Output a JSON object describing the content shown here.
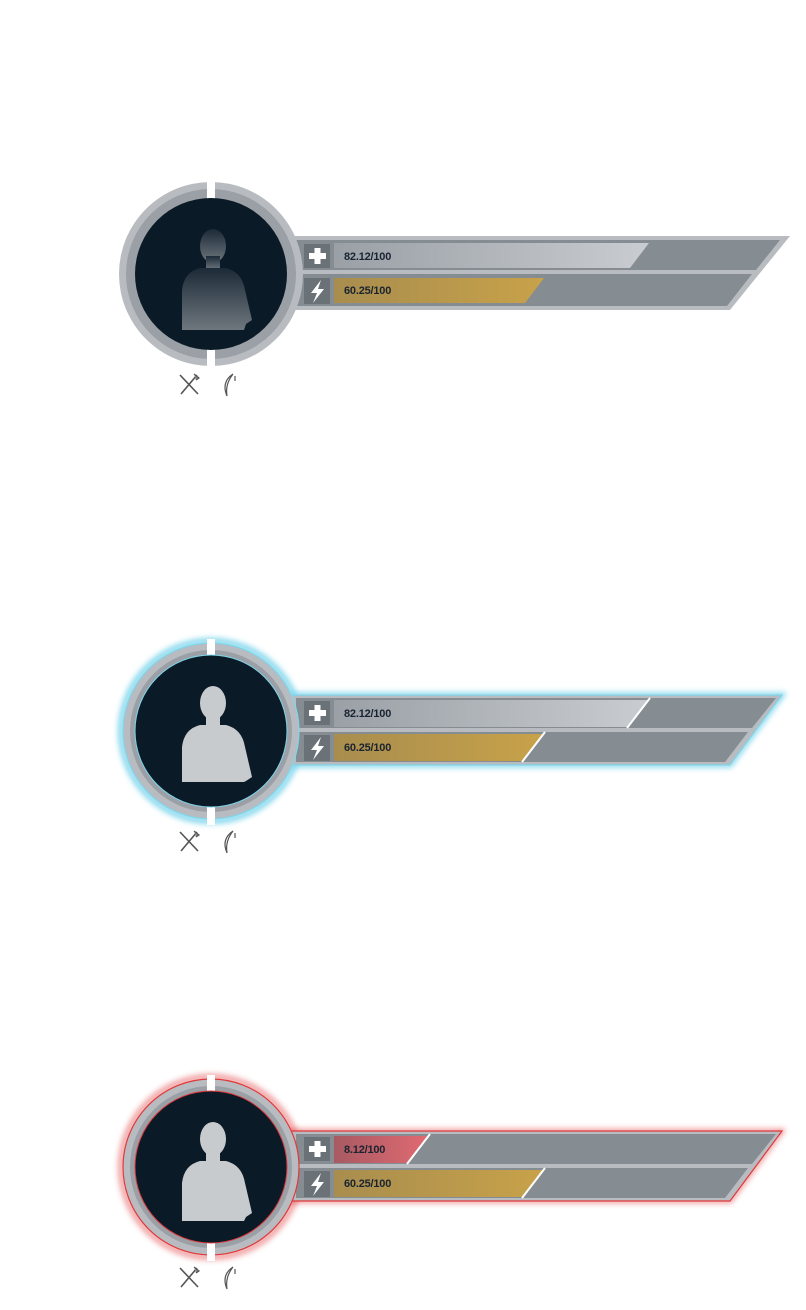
{
  "hud_panels": [
    {
      "state": "normal",
      "glow_color": "",
      "avatar_fill": "dark-gradient",
      "health": {
        "label": "82.12/100",
        "value": 82.12,
        "max": 100,
        "icon": "plus-icon"
      },
      "energy": {
        "label": "60.25/100",
        "value": 60.25,
        "max": 100,
        "icon": "lightning-icon"
      },
      "status_icons": [
        "crossed-tools-icon",
        "crescent-moon-icon"
      ]
    },
    {
      "state": "selected",
      "glow_color": "#7fd6ec",
      "avatar_fill": "light",
      "health": {
        "label": "82.12/100",
        "value": 82.12,
        "max": 100,
        "icon": "plus-icon"
      },
      "energy": {
        "label": "60.25/100",
        "value": 60.25,
        "max": 100,
        "icon": "lightning-icon"
      },
      "status_icons": [
        "crossed-tools-icon",
        "crescent-moon-icon"
      ]
    },
    {
      "state": "danger",
      "glow_color": "#e0393b",
      "avatar_fill": "light",
      "health": {
        "label": "8.12/100",
        "value": 8.12,
        "max": 100,
        "icon": "plus-icon"
      },
      "energy": {
        "label": "60.25/100",
        "value": 60.25,
        "max": 100,
        "icon": "lightning-icon"
      },
      "status_icons": [
        "crossed-tools-icon",
        "crescent-moon-icon"
      ]
    }
  ],
  "colors": {
    "frame_gray": "#858c92",
    "frame_light": "#b8bcc0",
    "avatar_bg": "#0b1a27",
    "health_fill": "#c3c6ca",
    "energy_fill": "#c7a24a",
    "danger_fill": "#d0646c"
  }
}
